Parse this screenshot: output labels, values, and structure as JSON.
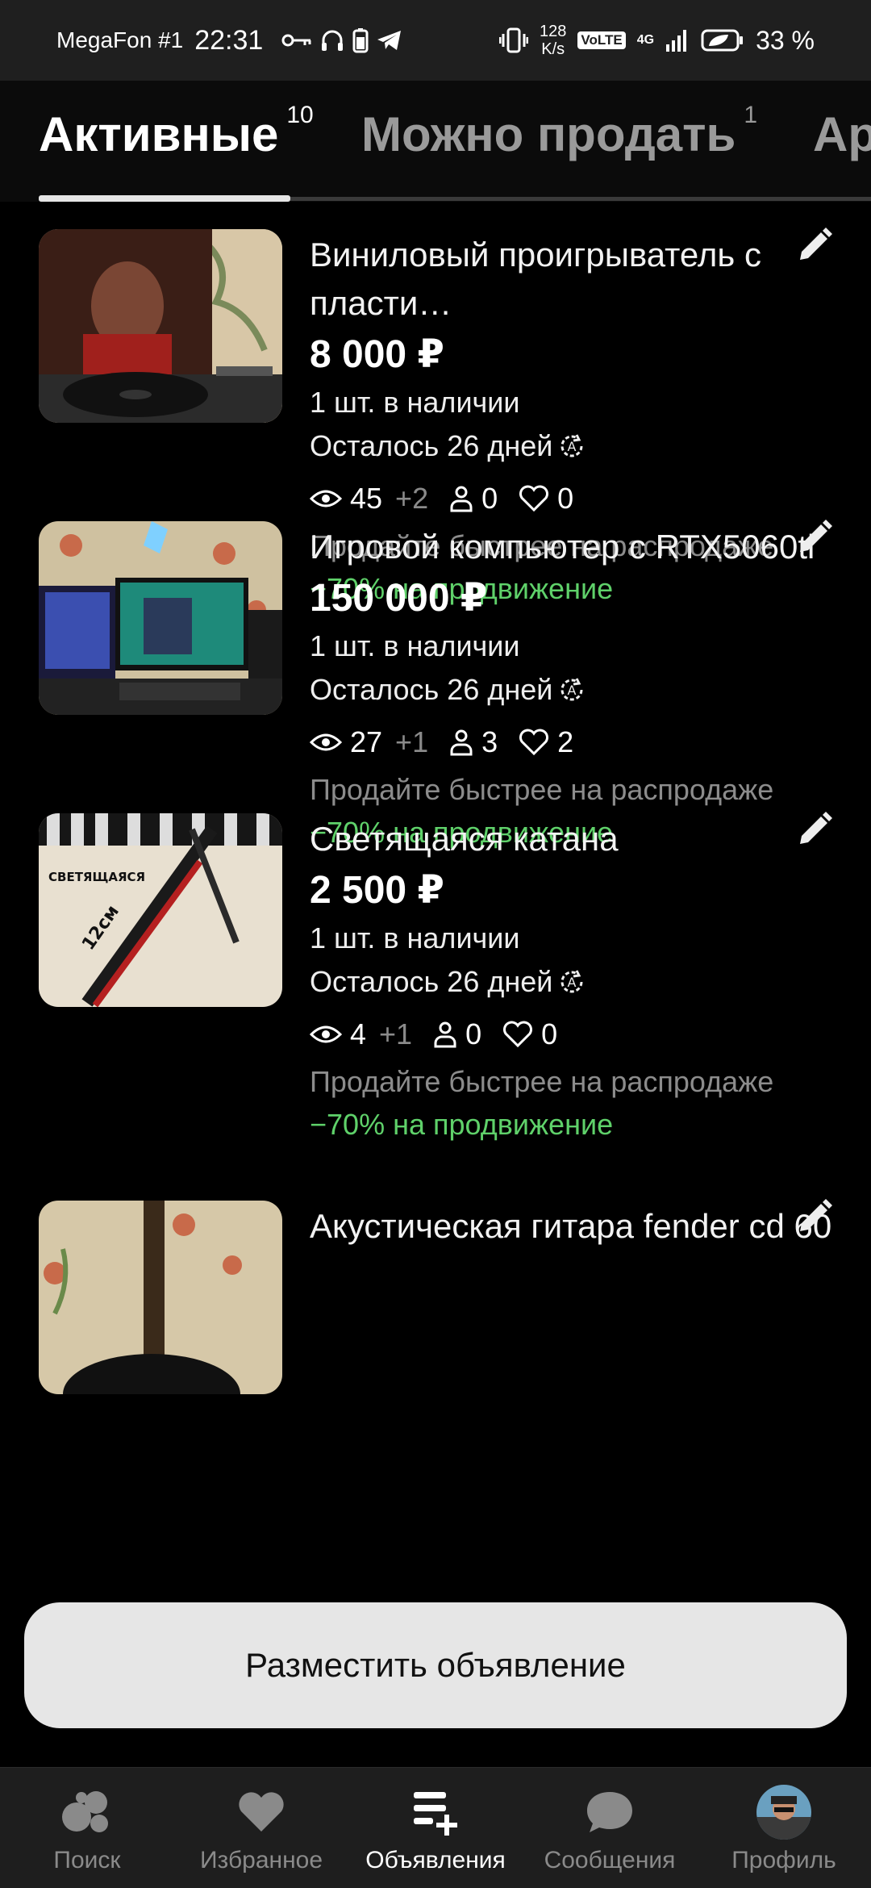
{
  "status_bar": {
    "carrier": "MegaFon #1",
    "time": "22:31",
    "speed_value": "128",
    "speed_unit": "K/s",
    "volte": "VoLTE",
    "network": "4G",
    "battery": "33 %"
  },
  "tabs": [
    {
      "label": "Активные",
      "count": "10"
    },
    {
      "label": "Можно продать",
      "count": "1"
    },
    {
      "label": "Ар",
      "count": ""
    }
  ],
  "listings": [
    {
      "title": "Виниловый проигрыватель с пласти…",
      "price": "8 000 ₽",
      "stock": "1 шт. в наличии",
      "days_left": "Осталось 26 дней",
      "views": "45",
      "views_delta": "+2",
      "contacts": "0",
      "favorites": "0",
      "promo": "Продайте быстрее на распродаже",
      "discount": "−70% на продвижение"
    },
    {
      "title": "Игровой компьютер с RTX5060ti",
      "price": "150 000 ₽",
      "stock": "1 шт. в наличии",
      "days_left": "Осталось 26 дней",
      "views": "27",
      "views_delta": "+1",
      "contacts": "3",
      "favorites": "2",
      "promo": "Продайте быстрее на распродаже",
      "discount": "−70% на продвижение"
    },
    {
      "title": "Светящаяся катана",
      "price": "2 500 ₽",
      "stock": "1 шт. в наличии",
      "days_left": "Осталось 26 дней",
      "views": "4",
      "views_delta": "+1",
      "contacts": "0",
      "favorites": "0",
      "promo": "Продайте быстрее на распродаже",
      "discount": "−70% на продвижение",
      "thumb_text": "СВЕТЯЩАЯСЯ",
      "thumb_size": "12см"
    },
    {
      "title": "Акустическая гитара fender cd 60"
    }
  ],
  "fab_label": "Разместить объявление",
  "bottom_nav": [
    {
      "label": "Поиск",
      "icon": "search-dots-icon"
    },
    {
      "label": "Избранное",
      "icon": "heart-icon"
    },
    {
      "label": "Объявления",
      "icon": "listings-add-icon",
      "active": true
    },
    {
      "label": "Сообщения",
      "icon": "chat-bubble-icon"
    },
    {
      "label": "Профиль",
      "icon": "avatar"
    }
  ],
  "colors": {
    "background": "#000000",
    "accent_green": "#5fd16a",
    "muted": "#8c8c8c",
    "fab": "#e6e6e6"
  }
}
